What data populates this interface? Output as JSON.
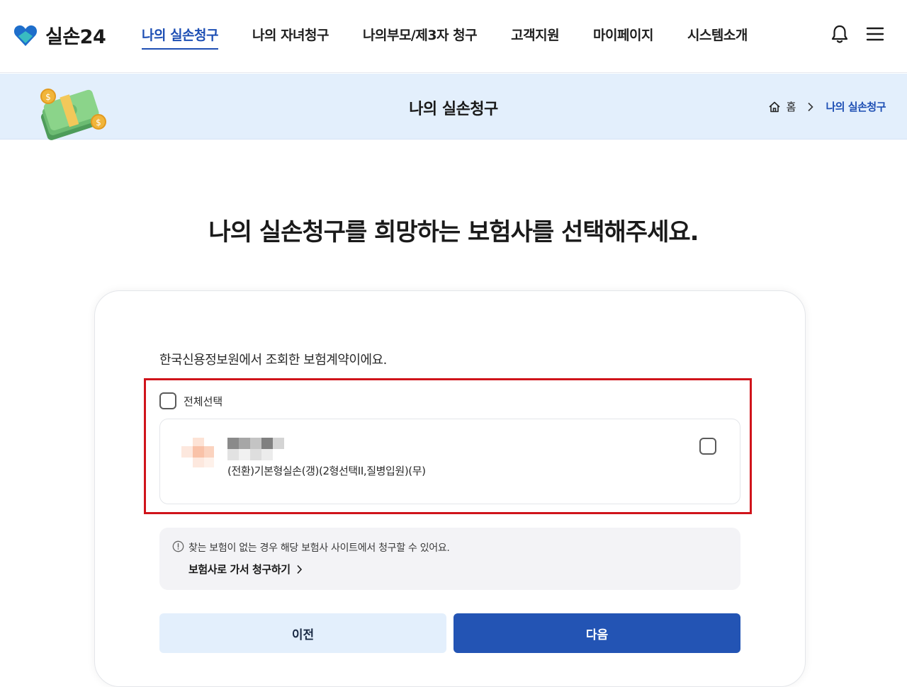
{
  "header": {
    "logo_text": "실손24",
    "nav": [
      {
        "label": "나의 실손청구",
        "active": true
      },
      {
        "label": "나의 자녀청구",
        "active": false
      },
      {
        "label": "나의부모/제3자 청구",
        "active": false
      },
      {
        "label": "고객지원",
        "active": false
      },
      {
        "label": "마이페이지",
        "active": false
      },
      {
        "label": "시스템소개",
        "active": false
      }
    ],
    "icons": [
      "bell-icon",
      "hamburger-menu-icon"
    ]
  },
  "banner": {
    "title": "나의 실손청구",
    "breadcrumb": {
      "home": "홈",
      "current": "나의 실손청구"
    }
  },
  "main": {
    "title": "나의 실손청구를 희망하는 보험사를 선택해주세요.",
    "subtitle": "한국신용정보원에서 조회한 보험계약이에요.",
    "select_all_label": "전체선택",
    "policies": [
      {
        "policy_name": "(전환)기본형실손(갱)(2형선택II,질병입원)(무)",
        "checked": false
      }
    ],
    "notice": {
      "text": "찾는 보험이 없는 경우 해당 보험사 사이트에서 청구할 수 있어요.",
      "link_label": "보험사로 가서 청구하기"
    },
    "buttons": {
      "prev": "이전",
      "next": "다음"
    }
  },
  "colors": {
    "brand_blue": "#1e4fb4",
    "primary_button": "#2354b4",
    "banner_bg": "#e3effc",
    "highlight_border": "#d0141b"
  }
}
